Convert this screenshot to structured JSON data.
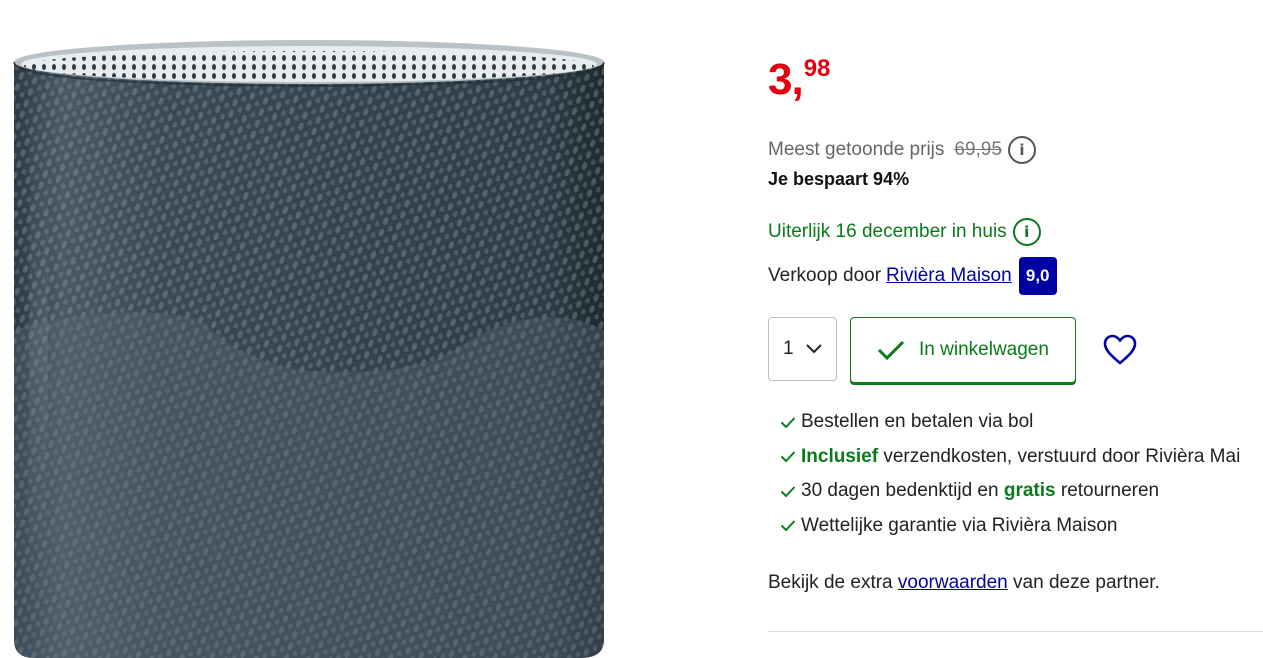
{
  "product_image": {
    "icon": "vase-image"
  },
  "price": {
    "main": "3,",
    "cents": "98"
  },
  "reference": {
    "label": "Meest getoonde prijs",
    "old_price": "69,95"
  },
  "saving": "Je bespaart 94%",
  "delivery": {
    "text": "Uiterlijk 16 december in huis"
  },
  "seller": {
    "prefix": "Verkoop door",
    "name": "Rivièra Maison",
    "rating": "9,0"
  },
  "quantity": {
    "value": "1"
  },
  "cart_button": {
    "label": "In winkelwagen"
  },
  "usps": {
    "item1": "Bestellen en betalen via bol",
    "item2_bold": "Inclusief",
    "item2_rest": " verzendkosten, verstuurd door Rivièra Mai",
    "item3_a": "30 dagen bedenktijd en ",
    "item3_bold": "gratis",
    "item3_b": " retourneren",
    "item4": "Wettelijke garantie via Rivièra Maison"
  },
  "terms": {
    "prefix": "Bekijk de extra ",
    "link": "voorwaarden",
    "suffix": " van deze partner."
  },
  "colors": {
    "price": "#e0000e",
    "green": "#0a7a1a",
    "link": "#0000a4",
    "badge": "#0000a4"
  }
}
